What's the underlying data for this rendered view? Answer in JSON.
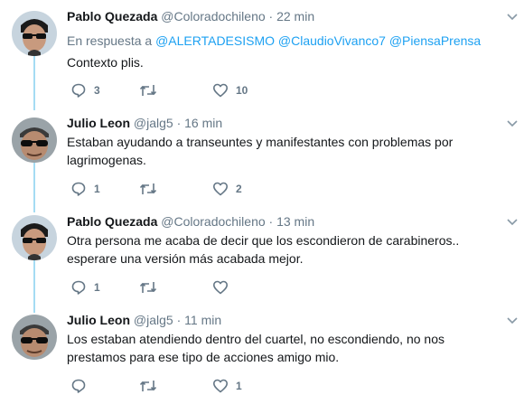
{
  "reply_prefix": "En respuesta a",
  "tweets": [
    {
      "name": "Pablo Quezada",
      "handle": "@Coloradochileno",
      "sep": "·",
      "time": "22 min",
      "mentions": [
        "@ALERTADESISMO",
        "@ClaudioVivanco7",
        "@PiensaPrensa"
      ],
      "text": "Contexto plis.",
      "replies": "3",
      "retweets": "",
      "likes": "10"
    },
    {
      "name": "Julio Leon",
      "handle": "@jalg5",
      "sep": "·",
      "time": "16 min",
      "text": "Estaban ayudando a transeuntes y manifestantes con problemas por lagrimogenas.",
      "replies": "1",
      "retweets": "",
      "likes": "2"
    },
    {
      "name": "Pablo Quezada",
      "handle": "@Coloradochileno",
      "sep": "·",
      "time": "13 min",
      "text": "Otra persona me acaba de decir que los escondieron de carabineros.. esperare una versión más acabada mejor.",
      "replies": "1",
      "retweets": "",
      "likes": ""
    },
    {
      "name": "Julio Leon",
      "handle": "@jalg5",
      "sep": "·",
      "time": "11 min",
      "text": "Los estaban atendiendo dentro del cuartel, no escondiendo, no nos prestamos para ese tipo de acciones amigo mio.",
      "replies": "",
      "retweets": "",
      "likes": "1"
    }
  ],
  "icons": {
    "reply": "reply-icon",
    "retweet": "retweet-icon",
    "like": "heart-icon",
    "caret": "chevron-down-icon"
  },
  "colors": {
    "link": "#1da1f2",
    "muted": "#657786",
    "text": "#14171a",
    "thread_line": "#a5dcf3"
  }
}
